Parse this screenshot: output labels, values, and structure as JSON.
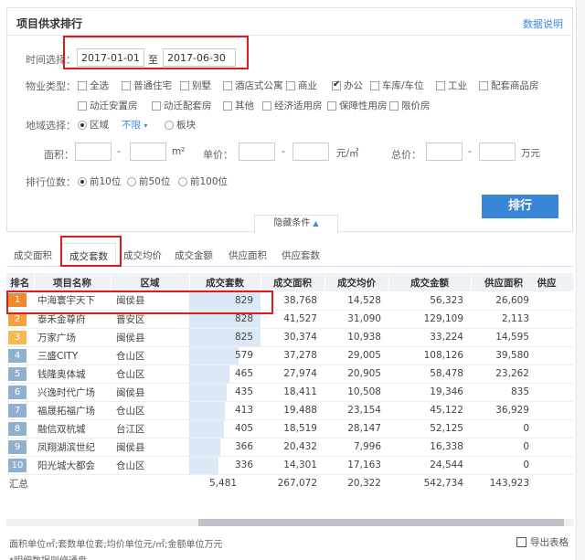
{
  "header": {
    "title": "项目供求排行",
    "help_link": "数据说明"
  },
  "filters": {
    "time_label": "时间选择：",
    "date_from": "2017-01-01",
    "date_sep": "至",
    "date_to": "2017-06-30",
    "property_label": "物业类型：",
    "property_types": [
      {
        "label": "全选",
        "checked": false
      },
      {
        "label": "普通住宅",
        "checked": false
      },
      {
        "label": "别墅",
        "checked": false
      },
      {
        "label": "酒店式公寓",
        "checked": false
      },
      {
        "label": "商业",
        "checked": false
      },
      {
        "label": "办公",
        "checked": true
      },
      {
        "label": "车库/车位",
        "checked": false
      },
      {
        "label": "工业",
        "checked": false
      },
      {
        "label": "配套商品房",
        "checked": false
      },
      {
        "label": "动迁安置房",
        "checked": false
      },
      {
        "label": "动迁配套房",
        "checked": false
      },
      {
        "label": "其他",
        "checked": false
      },
      {
        "label": "经济适用房",
        "checked": false
      },
      {
        "label": "保障性用房",
        "checked": false
      },
      {
        "label": "限价房",
        "checked": false
      }
    ],
    "region_label": "地域选择：",
    "region_option_district": "区域",
    "region_dropdown": "不限",
    "region_option_plate": "板块",
    "area_label": "面积：",
    "area_unit": "m²",
    "dash": "-",
    "price_label": "单价：",
    "price_unit": "元/㎡",
    "total_label": "总价：",
    "total_unit": "万元",
    "rank_label": "排行位数：",
    "rank_options": [
      "前10位",
      "前50位",
      "前100位"
    ],
    "rank_button": "排行",
    "hide_conditions": "隐藏条件"
  },
  "tabs": [
    "成交面积",
    "成交套数",
    "成交均价",
    "成交金额",
    "供应面积",
    "供应套数"
  ],
  "table": {
    "columns": [
      "排名",
      "项目名称",
      "区域",
      "成交套数",
      "成交面积",
      "成交均价",
      "成交金额",
      "供应面积",
      "供应"
    ],
    "rows": [
      {
        "rank": "1",
        "name": "中海寰宇天下",
        "district": "闽侯县",
        "sets": "829",
        "area": "38,768",
        "avg": "14,528",
        "amount": "56,323",
        "supply": "26,609",
        "color": "#f0892c",
        "share": 1.0
      },
      {
        "rank": "2",
        "name": "泰禾金尊府",
        "district": "晋安区",
        "sets": "828",
        "area": "41,527",
        "avg": "31,090",
        "amount": "129,109",
        "supply": "2,113",
        "color": "#f2a13c",
        "share": 0.999
      },
      {
        "rank": "3",
        "name": "万家广场",
        "district": "闽侯县",
        "sets": "825",
        "area": "30,374",
        "avg": "10,938",
        "amount": "33,224",
        "supply": "14,595",
        "color": "#f5b94f",
        "share": 0.995
      },
      {
        "rank": "4",
        "name": "三盛CITY",
        "district": "仓山区",
        "sets": "579",
        "area": "37,278",
        "avg": "29,005",
        "amount": "108,126",
        "supply": "39,580",
        "color": "#8fb0cf",
        "share": 0.698
      },
      {
        "rank": "5",
        "name": "钱隆奥体城",
        "district": "仓山区",
        "sets": "465",
        "area": "27,974",
        "avg": "20,905",
        "amount": "58,478",
        "supply": "23,262",
        "color": "#8fb0cf",
        "share": 0.561
      },
      {
        "rank": "6",
        "name": "兴逸时代广场",
        "district": "闽侯县",
        "sets": "435",
        "area": "18,411",
        "avg": "10,508",
        "amount": "19,346",
        "supply": "835",
        "color": "#8fb0cf",
        "share": 0.525
      },
      {
        "rank": "7",
        "name": "福晟拓福广场",
        "district": "仓山区",
        "sets": "413",
        "area": "19,488",
        "avg": "23,154",
        "amount": "45,122",
        "supply": "36,929",
        "color": "#8fb0cf",
        "share": 0.498
      },
      {
        "rank": "8",
        "name": "融信双杭城",
        "district": "台江区",
        "sets": "405",
        "area": "18,519",
        "avg": "28,147",
        "amount": "52,125",
        "supply": "0",
        "color": "#8fb0cf",
        "share": 0.489
      },
      {
        "rank": "9",
        "name": "凤翔湖滨世纪",
        "district": "闽侯县",
        "sets": "366",
        "area": "20,432",
        "avg": "7,996",
        "amount": "16,338",
        "supply": "0",
        "color": "#8fb0cf",
        "share": 0.441
      },
      {
        "rank": "10",
        "name": "阳光城大都会",
        "district": "仓山区",
        "sets": "336",
        "area": "14,301",
        "avg": "17,163",
        "amount": "24,544",
        "supply": "0",
        "color": "#8fb0cf",
        "share": 0.405
      }
    ],
    "total": {
      "label": "汇总",
      "sets": "5,481",
      "area": "267,072",
      "avg": "20,322",
      "amount": "542,734",
      "supply": "143,923"
    }
  },
  "footer": {
    "units_note": "面积单位㎡;套数单位套;均价单位元/㎡;金额单位万元",
    "export_label": "导出表格",
    "note2": "*明细数据则修通盘"
  }
}
